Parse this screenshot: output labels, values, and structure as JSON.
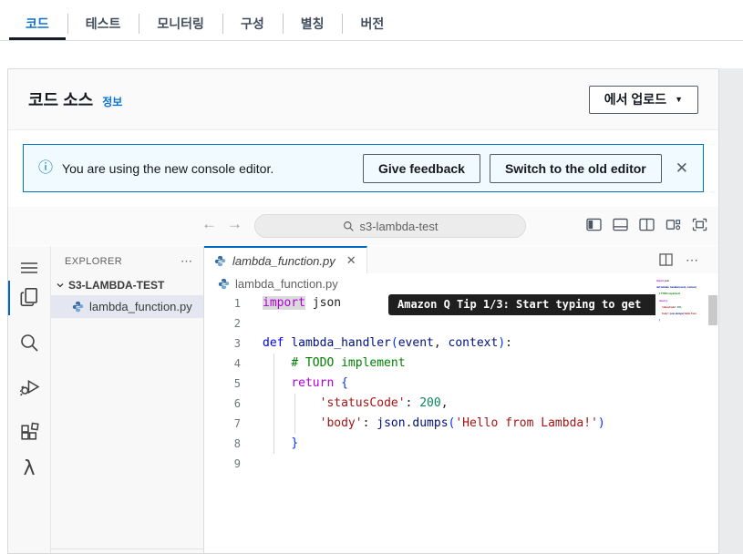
{
  "colors": {
    "accent_blue": "#0972d3",
    "banner_border": "#0073bb",
    "banner_bg": "#f1faff",
    "tab_active_border": "#0067c5",
    "selection_bg": "#e4e6f1"
  },
  "function_tabs": {
    "items": [
      {
        "label": "코드",
        "active": true
      },
      {
        "label": "테스트",
        "active": false
      },
      {
        "label": "모니터링",
        "active": false
      },
      {
        "label": "구성",
        "active": false
      },
      {
        "label": "별칭",
        "active": false
      },
      {
        "label": "버전",
        "active": false
      }
    ]
  },
  "code_source": {
    "title": "코드 소스",
    "info_link": "정보",
    "upload_button": "에서 업로드"
  },
  "banner": {
    "message": "You are using the new console editor.",
    "feedback_button": "Give feedback",
    "switch_button": "Switch to the old editor"
  },
  "toolbar": {
    "search_value": "s3-lambda-test"
  },
  "explorer": {
    "header": "EXPLORER",
    "root_folder": "S3-LAMBDA-TEST",
    "file": "lambda_function.py"
  },
  "editor": {
    "tab_label": "lambda_function.py",
    "breadcrumb": "lambda_function.py",
    "tooltip": "Amazon Q Tip 1/3: Start typing to get",
    "lines": [
      {
        "num": "1",
        "tokens": [
          [
            "kw-import",
            "import"
          ],
          [
            "plain",
            " json"
          ]
        ]
      },
      {
        "num": "2",
        "tokens": []
      },
      {
        "num": "3",
        "tokens": [
          [
            "kw-def",
            "def"
          ],
          [
            "plain",
            " "
          ],
          [
            "fn",
            "lambda_handler"
          ],
          [
            "paren",
            "("
          ],
          [
            "param",
            "event"
          ],
          [
            "plain",
            ", "
          ],
          [
            "param",
            "context"
          ],
          [
            "paren",
            ")"
          ],
          [
            "plain",
            ":"
          ]
        ]
      },
      {
        "num": "4",
        "tokens": [
          [
            "plain",
            "    "
          ],
          [
            "comment",
            "# TODO implement"
          ]
        ]
      },
      {
        "num": "5",
        "tokens": [
          [
            "plain",
            "    "
          ],
          [
            "kw",
            "return"
          ],
          [
            "plain",
            " "
          ],
          [
            "paren",
            "{"
          ]
        ]
      },
      {
        "num": "6",
        "tokens": [
          [
            "plain",
            "        "
          ],
          [
            "str",
            "'statusCode'"
          ],
          [
            "plain",
            ": "
          ],
          [
            "num",
            "200"
          ],
          [
            "plain",
            ","
          ]
        ]
      },
      {
        "num": "7",
        "tokens": [
          [
            "plain",
            "        "
          ],
          [
            "str",
            "'body'"
          ],
          [
            "plain",
            ": "
          ],
          [
            "param",
            "json"
          ],
          [
            "plain",
            "."
          ],
          [
            "fn",
            "dumps"
          ],
          [
            "paren",
            "("
          ],
          [
            "str",
            "'Hello from Lambda!'"
          ],
          [
            "paren",
            ")"
          ]
        ]
      },
      {
        "num": "8",
        "tokens": [
          [
            "plain",
            "    "
          ],
          [
            "paren",
            "}"
          ]
        ]
      },
      {
        "num": "9",
        "tokens": []
      }
    ]
  },
  "icons": {
    "caret_down": "▼",
    "close": "✕",
    "dots": "⋯",
    "back_arrow": "←",
    "forward_arrow": "→",
    "info": "ⓘ",
    "lambda_glyph": "λ"
  }
}
